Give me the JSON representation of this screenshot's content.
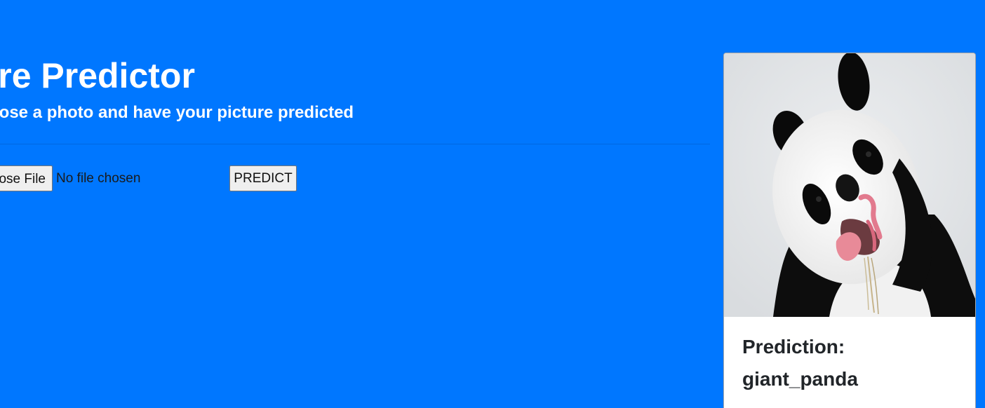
{
  "header": {
    "title": "Picture Predictor",
    "subtitle": "Choose a photo and have your picture predicted"
  },
  "upload": {
    "choose_file_label": "Choose File",
    "file_status": "No file chosen",
    "predict_label": "PREDICT"
  },
  "result": {
    "prediction_label": "Prediction:",
    "prediction_value": "giant_panda",
    "image_alt": "giant panda photo"
  },
  "colors": {
    "background": "#0077ff",
    "card": "#ffffff",
    "text_dark": "#212529"
  }
}
